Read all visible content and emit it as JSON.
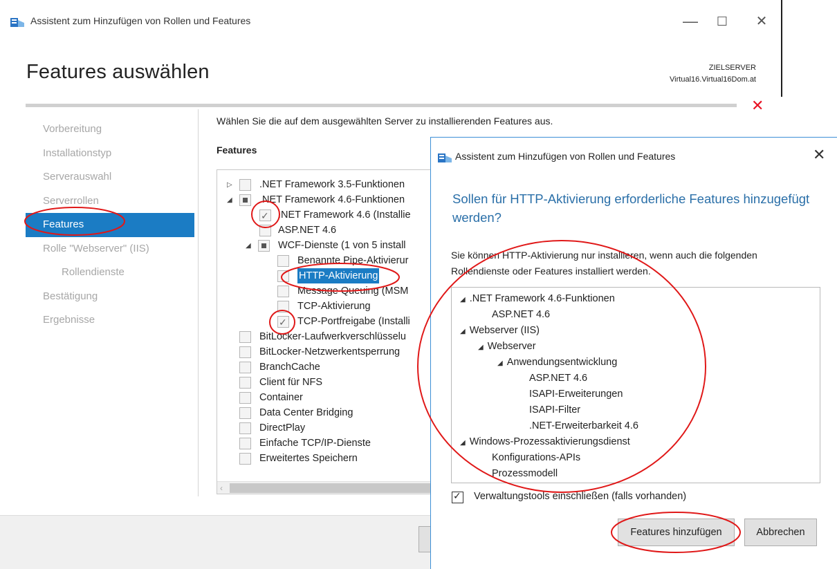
{
  "main_window": {
    "title": "Assistent zum Hinzufügen von Rollen und Features",
    "controls": {
      "minimize": "—",
      "maximize": "☐",
      "close": "✕"
    },
    "page_title": "Features auswählen",
    "target_server_label": "ZIELSERVER",
    "target_server_name": "Virtual16.Virtual16Dom.at",
    "nav": [
      {
        "label": "Vorbereitung",
        "state": "inactive"
      },
      {
        "label": "Installationstyp",
        "state": "inactive"
      },
      {
        "label": "Serverauswahl",
        "state": "inactive"
      },
      {
        "label": "Serverrollen",
        "state": "inactive"
      },
      {
        "label": "Features",
        "state": "active"
      },
      {
        "label": "Rolle \"Webserver\" (IIS)",
        "state": "inactive"
      },
      {
        "label": "Rollendienste",
        "state": "inactive"
      },
      {
        "label": "Bestätigung",
        "state": "inactive"
      },
      {
        "label": "Ergebnisse",
        "state": "inactive"
      }
    ],
    "description": "Wählen Sie die auf dem ausgewählten Server zu installierenden Features aus.",
    "features_heading": "Features",
    "features": [
      {
        "label": ".NET Framework 3.5-Funktionen",
        "expander": "collapsed",
        "check": "none"
      },
      {
        "label": ".NET Framework 4.6-Funktionen",
        "expander": "expanded",
        "check": "partial"
      },
      {
        "label": ".NET Framework 4.6 (Installie",
        "expander": "",
        "check": "checked"
      },
      {
        "label": "ASP.NET 4.6",
        "expander": "",
        "check": "none"
      },
      {
        "label": "WCF-Dienste (1 von 5 install",
        "expander": "expanded",
        "check": "partial"
      },
      {
        "label": "Benannte Pipe-Aktivierur",
        "expander": "",
        "check": "none"
      },
      {
        "label": "HTTP-Aktivierung",
        "expander": "",
        "check": "none",
        "selected": true
      },
      {
        "label": "Message Queuing (MSM",
        "expander": "",
        "check": "none"
      },
      {
        "label": "TCP-Aktivierung",
        "expander": "",
        "check": "none"
      },
      {
        "label": "TCP-Portfreigabe (Installi",
        "expander": "",
        "check": "checked"
      },
      {
        "label": "BitLocker-Laufwerkverschlüsselu",
        "expander": "",
        "check": "none"
      },
      {
        "label": "BitLocker-Netzwerkentsperrung",
        "expander": "",
        "check": "none"
      },
      {
        "label": "BranchCache",
        "expander": "",
        "check": "none"
      },
      {
        "label": "Client für NFS",
        "expander": "",
        "check": "none"
      },
      {
        "label": "Container",
        "expander": "",
        "check": "none"
      },
      {
        "label": "Data Center Bridging",
        "expander": "",
        "check": "none"
      },
      {
        "label": "DirectPlay",
        "expander": "",
        "check": "none"
      },
      {
        "label": "Einfache TCP/IP-Dienste",
        "expander": "",
        "check": "none"
      },
      {
        "label": "Erweitertes Speichern",
        "expander": "",
        "check": "none"
      }
    ],
    "close_mark": "✕"
  },
  "dialog": {
    "title": "Assistent zum Hinzufügen von Rollen und Features",
    "close": "✕",
    "heading": "Sollen für HTTP-Aktivierung erforderliche Features hinzugefügt werden?",
    "text": "Sie können HTTP-Aktivierung nur installieren, wenn auch die folgenden Rollendienste oder Features installiert werden.",
    "required_items": [
      {
        "label": ".NET Framework 4.6-Funktionen",
        "expander": true
      },
      {
        "label": "ASP.NET 4.6",
        "expander": false
      },
      {
        "label": "Webserver (IIS)",
        "expander": true
      },
      {
        "label": "Webserver",
        "expander": true
      },
      {
        "label": "Anwendungsentwicklung",
        "expander": true
      },
      {
        "label": "ASP.NET 4.6",
        "expander": false
      },
      {
        "label": "ISAPI-Erweiterungen",
        "expander": false
      },
      {
        "label": "ISAPI-Filter",
        "expander": false
      },
      {
        "label": ".NET-Erweiterbarkeit 4.6",
        "expander": false
      },
      {
        "label": "Windows-Prozessaktivierungsdienst",
        "expander": true
      },
      {
        "label": "Konfigurations-APIs",
        "expander": false
      },
      {
        "label": "Prozessmodell",
        "expander": false
      }
    ],
    "include_tools_label": "Verwaltungstools einschließen (falls vorhanden)",
    "include_tools_checked": true,
    "add_button": "Features hinzufügen",
    "cancel_button": "Abbrechen"
  },
  "colors": {
    "accent": "#1b7cc4",
    "heading_blue": "#2a6fa8",
    "annotation_red": "#e01818",
    "error_red": "#e81123"
  }
}
